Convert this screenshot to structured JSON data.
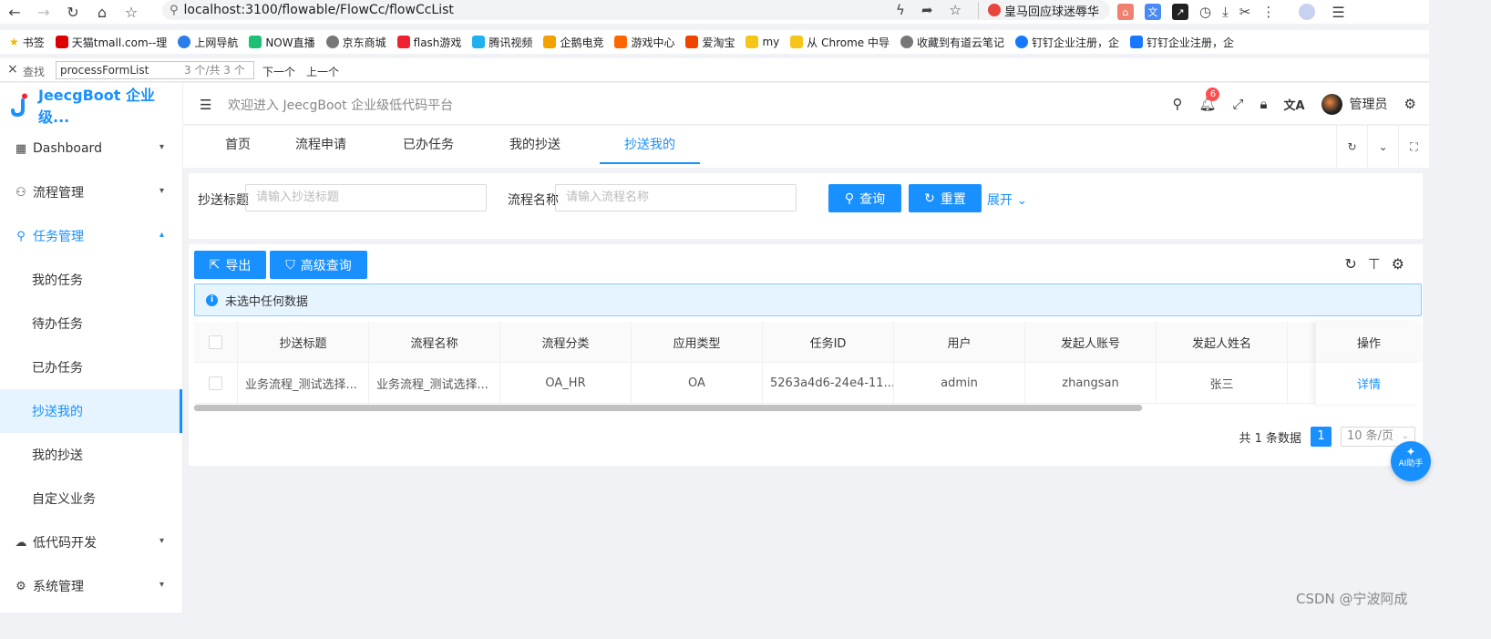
{
  "browser": {
    "url": "localhost:3100/flowable/FlowCc/flowCcList",
    "search_engine_text": "皇马回应球迷辱华",
    "bookmarks": [
      "书签",
      "天猫tmall.com--理",
      "上网导航",
      "NOW直播",
      "京东商城",
      "flash游戏",
      "腾讯视频",
      "企鹅电竞",
      "游戏中心",
      "爱淘宝",
      "my",
      "从 Chrome 中导",
      "收藏到有道云笔记",
      "钉钉企业注册，企",
      "钉钉企业注册，企"
    ],
    "find": {
      "label": "查找",
      "value": "processFormList",
      "count": "3 个/共 3 个",
      "next": "下一个",
      "prev": "上一个"
    }
  },
  "app": {
    "logo_title": "JeecgBoot 企业级...",
    "welcome": "欢迎进入 JeecgBoot 企业级低代码平台",
    "notification_count": "6",
    "username": "管理员"
  },
  "sidebar": {
    "menus": [
      {
        "label": "Dashboard",
        "icon": "grid-icon"
      },
      {
        "label": "流程管理",
        "icon": "flow-icon"
      },
      {
        "label": "任务管理",
        "icon": "task-icon"
      }
    ],
    "sub_items": [
      "我的任务",
      "待办任务",
      "已办任务",
      "抄送我的",
      "我的抄送",
      "自定义业务"
    ],
    "menus_bottom": [
      {
        "label": "低代码开发",
        "icon": "cloud-icon"
      },
      {
        "label": "系统管理",
        "icon": "gear-icon"
      }
    ]
  },
  "tabs": [
    "首页",
    "流程申请",
    "已办任务",
    "我的抄送",
    "抄送我的"
  ],
  "search": {
    "title_label": "抄送标题",
    "title_placeholder": "请输入抄送标题",
    "flow_label": "流程名称",
    "flow_placeholder": "请输入流程名称",
    "query": "查询",
    "reset": "重置",
    "expand": "展开"
  },
  "toolbar": {
    "export": "导出",
    "advanced": "高级查询"
  },
  "alert": "未选中任何数据",
  "table": {
    "columns": [
      "抄送标题",
      "流程名称",
      "流程分类",
      "应用类型",
      "任务ID",
      "用户",
      "发起人账号",
      "发起人姓名",
      "",
      "操作"
    ],
    "rows": [
      [
        "业务流程_测试选择...",
        "业务流程_测试选择...",
        "OA_HR",
        "OA",
        "5263a4d6-24e4-11...",
        "admin",
        "zhangsan",
        "张三",
        "",
        "详情"
      ]
    ]
  },
  "pagination": {
    "total": "共 1 条数据",
    "page": "1",
    "size": "10 条/页"
  },
  "ai": {
    "label": "AI助手"
  },
  "watermark": "CSDN @宁波阿成"
}
